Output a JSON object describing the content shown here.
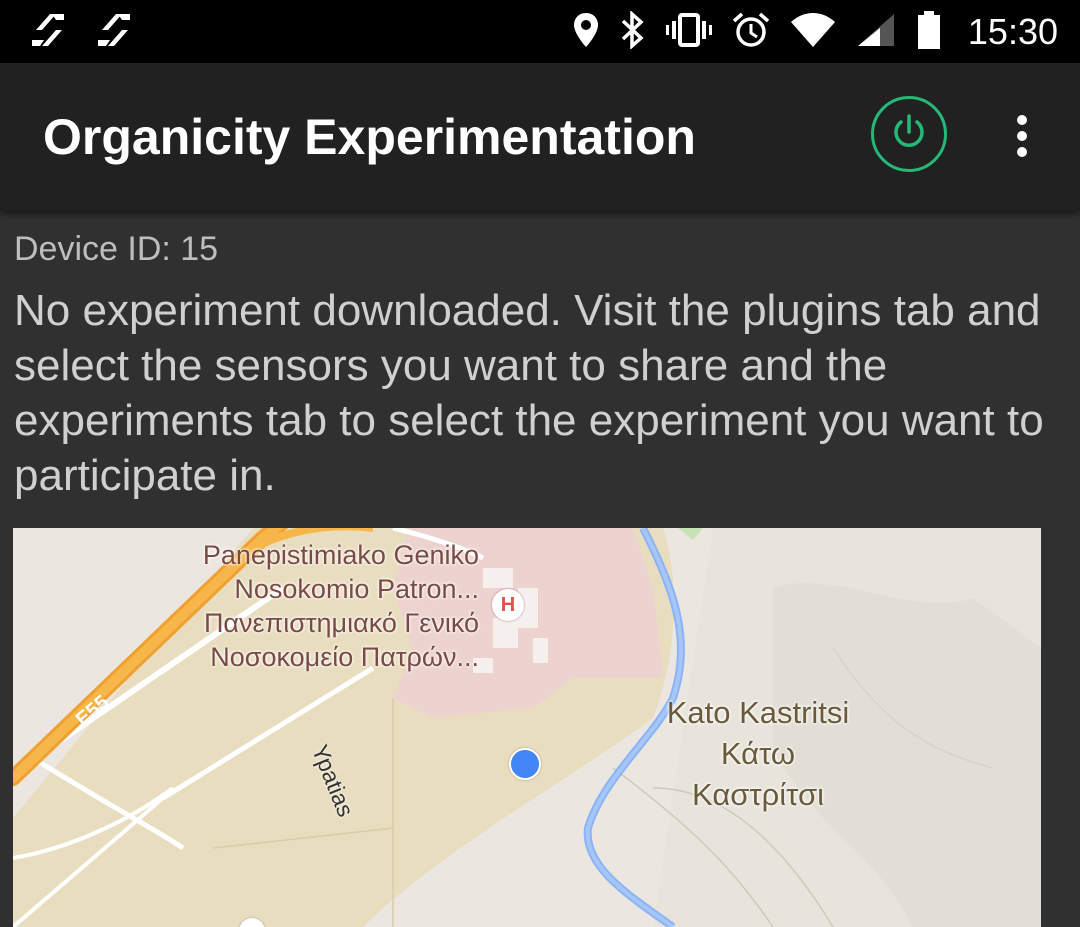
{
  "status_bar": {
    "time": "15:30",
    "left_icons": [
      "sync-app-icon",
      "sync-app-icon"
    ],
    "right_icons": [
      "location-icon",
      "bluetooth-icon",
      "vibrate-icon",
      "alarm-icon",
      "wifi-icon",
      "cell-signal-icon",
      "battery-icon"
    ]
  },
  "app_bar": {
    "title": "Organicity Experimentation",
    "power_color": "#26b877"
  },
  "content": {
    "device_id": "Device ID: 15",
    "message": "No experiment downloaded. Visit the plugins tab and select the sensors you want to share and the experiments tab to select the experiment you want to participate in."
  },
  "map": {
    "hospital_label": {
      "line1": "Panepistimiako Geniko",
      "line2": "Nosokomio Patron...",
      "line3": "Πανεπιστημιακό Γενικό",
      "line4": "Νοσοκομείο Πατρών..."
    },
    "hospital_marker": "H",
    "road_shield": "E55",
    "street_label": "Ypatias",
    "town_label": {
      "line1": "Kato Kastritsi",
      "line2": "Κάτω",
      "line3": "Καστρίτσι"
    },
    "location_dot_color": "#4285f4"
  }
}
